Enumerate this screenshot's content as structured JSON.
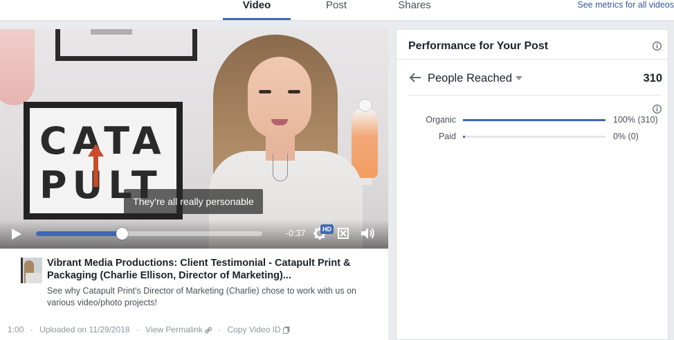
{
  "tabs": [
    {
      "label": "Video",
      "active": true
    },
    {
      "label": "Post",
      "active": false
    },
    {
      "label": "Shares",
      "active": false
    }
  ],
  "metrics_link": "See metrics for all videos",
  "video": {
    "caption": "They're all really personable",
    "time_remaining": "-0:37",
    "hd_label": "HD",
    "progress_fraction": 0.38,
    "colors": {
      "accent": "#4267b2"
    }
  },
  "video_info": {
    "title": "Vibrant Media Productions: Client Testimonial - Catapult Print & Packaging (Charlie Ellison, Director of Marketing)...",
    "description": "See why Catapult Print's Director of Marketing (Charlie) chose to work with us on various video/photo projects!",
    "duration": "1:00",
    "uploaded": "Uploaded on 11/29/2018",
    "permalink_label": "View Permalink",
    "copy_id_label": "Copy Video ID",
    "separator": "·"
  },
  "performance": {
    "title": "Performance for Your Post",
    "metric_label": "People Reached",
    "metric_value": "310",
    "rows": [
      {
        "label": "Organic",
        "percent": 100,
        "pct_text": "100% (310)"
      },
      {
        "label": "Paid",
        "percent": 0,
        "pct_text": "0% (0)"
      }
    ]
  },
  "icons": {
    "play": "play-icon",
    "gear": "gear-icon",
    "fullscreen": "fullscreen-icon",
    "volume": "volume-icon",
    "info": "info-icon",
    "back": "back-arrow-icon",
    "caret": "caret-down-icon",
    "link": "link-icon",
    "copy": "copy-icon"
  }
}
